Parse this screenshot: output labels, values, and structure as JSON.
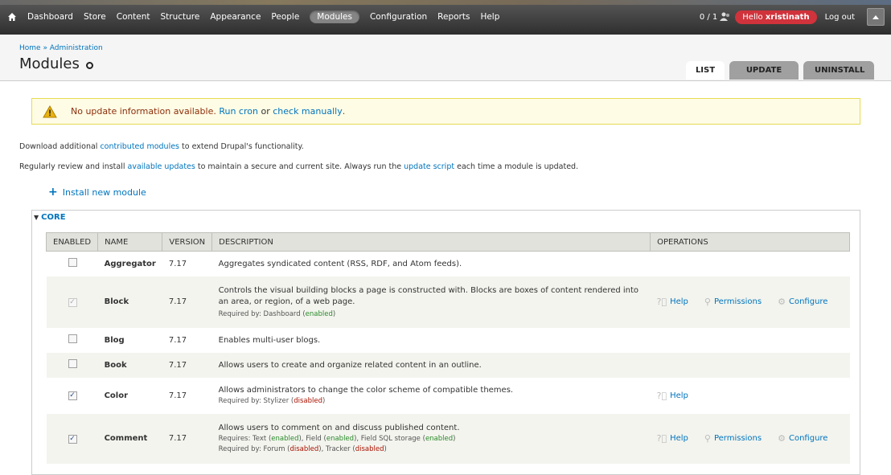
{
  "toolbar": {
    "home_icon": "home-icon",
    "items": [
      "Dashboard",
      "Store",
      "Content",
      "Structure",
      "Appearance",
      "People",
      "Modules",
      "Configuration",
      "Reports",
      "Help"
    ],
    "active": "Modules",
    "users_count": "0 / 1",
    "hello_prefix": "Hello",
    "username": "xristinath",
    "logout": "Log out"
  },
  "header": {
    "breadcrumb": "Home » Administration",
    "title": "Modules",
    "tabs": [
      "LIST",
      "UPDATE",
      "UNINSTALL"
    ]
  },
  "warning": {
    "text_prefix": "No update information available.",
    "link1": "Run cron",
    "connector": "or",
    "link2": "check manually",
    "end": "."
  },
  "intro1": {
    "a": "Download additional ",
    "link": "contributed modules",
    "b": " to extend Drupal's functionality."
  },
  "intro2": {
    "a": "Regularly review and install ",
    "link1": "available updates",
    "b": " to maintain a secure and current site. Always run the ",
    "link2": "update script",
    "c": " each time a module is updated."
  },
  "install_link": "Install new module",
  "core": {
    "legend": "CORE",
    "columns": [
      "ENABLED",
      "NAME",
      "VERSION",
      "DESCRIPTION",
      "OPERATIONS"
    ],
    "rows": [
      {
        "name": "Aggregator",
        "version": "7.17",
        "desc": "Aggregates syndicated content (RSS, RDF, and Atom feeds)."
      },
      {
        "name": "Block",
        "version": "7.17",
        "desc": "Controls the visual building blocks a page is constructed with. Blocks are boxes of content rendered into an area, or region, of a web page.",
        "req_label": "Required by: Dashboard (",
        "req_status": "enabled",
        "req_end": ")",
        "ops": [
          "Help",
          "Permissions",
          "Configure"
        ]
      },
      {
        "name": "Blog",
        "version": "7.17",
        "desc": "Enables multi-user blogs."
      },
      {
        "name": "Book",
        "version": "7.17",
        "desc": "Allows users to create and organize related content in an outline."
      },
      {
        "name": "Color",
        "version": "7.17",
        "desc": "Allows administrators to change the color scheme of compatible themes.",
        "req_label": "Required by: Stylizer (",
        "req_status": "disabled",
        "req_end": ")",
        "ops": [
          "Help"
        ]
      },
      {
        "name": "Comment",
        "version": "7.17",
        "desc": "Allows users to comment on and discuss published content.",
        "requires": "Requires: Text (",
        "r1": "enabled",
        "m1": "), Field (",
        "r2": "enabled",
        "m2": "), Field SQL storage (",
        "r3": "enabled",
        "m3": ")",
        "req_label": "Required by: Forum (",
        "req_status": "disabled",
        "req_mid": "), Tracker (",
        "req_status2": "disabled",
        "req_end": ")",
        "ops": [
          "Help",
          "Permissions",
          "Configure"
        ]
      }
    ]
  },
  "colors": {
    "accent": "#0074bd",
    "alert": "#d0333b",
    "warning_bg": "#fffce5"
  }
}
